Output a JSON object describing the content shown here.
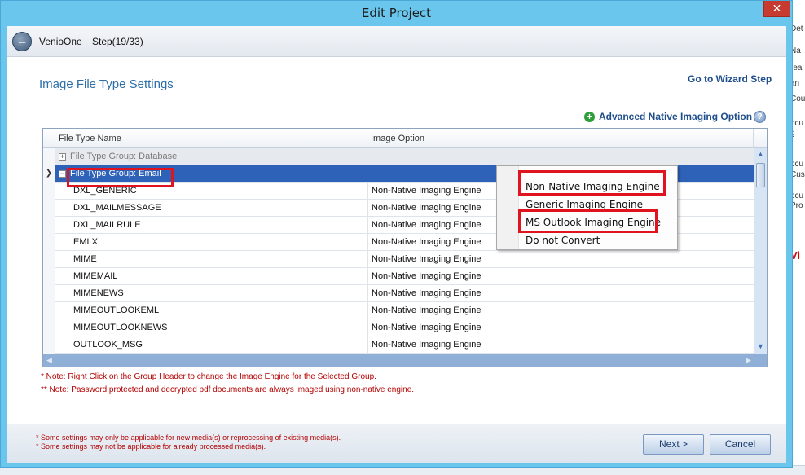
{
  "window": {
    "title": "Edit Project",
    "close_label": "✕"
  },
  "nav": {
    "app": "VenioOne",
    "step": "Step(19/33)"
  },
  "page": {
    "title": "Image File Type Settings",
    "wizard_link": "Go to Wizard Step",
    "advanced_option": "Advanced Native Imaging Option"
  },
  "grid": {
    "headers": [
      "File Type Name",
      "Image Option"
    ],
    "groups": [
      {
        "label": "File Type Group: Database",
        "expand_symbol": "+"
      },
      {
        "label": "File Type Group: Email",
        "expand_symbol": "−",
        "selected": true
      }
    ],
    "rows": [
      {
        "name": "DXL_GENERIC",
        "option": "Non-Native Imaging Engine"
      },
      {
        "name": "DXL_MAILMESSAGE",
        "option": "Non-Native Imaging Engine"
      },
      {
        "name": "DXL_MAILRULE",
        "option": "Non-Native Imaging Engine"
      },
      {
        "name": "EMLX",
        "option": "Non-Native Imaging Engine"
      },
      {
        "name": "MIME",
        "option": "Non-Native Imaging Engine"
      },
      {
        "name": "MIMEMAIL",
        "option": "Non-Native Imaging Engine"
      },
      {
        "name": "MIMENEWS",
        "option": "Non-Native Imaging Engine"
      },
      {
        "name": "MIMEOUTLOOKEML",
        "option": "Non-Native Imaging Engine"
      },
      {
        "name": "MIMEOUTLOOKNEWS",
        "option": "Non-Native Imaging Engine"
      },
      {
        "name": "OUTLOOK_MSG",
        "option": "Non-Native Imaging Engine"
      }
    ]
  },
  "context_menu": {
    "items": [
      "Non-Native Imaging Engine",
      "Generic Imaging Engine",
      "MS Outlook Imaging Engine",
      "Do not Convert"
    ]
  },
  "notes": {
    "note1": "* Note: Right Click on the Group Header to change the Image Engine for the Selected Group.",
    "note2": "** Note: Password protected and decrypted pdf documents are always imaged using non-native engine."
  },
  "footer": {
    "note1": "* Some settings may only be applicable for new media(s) or reprocessing of existing media(s).",
    "note2": "* Some settings may not be applicable for already processed media(s).",
    "next_label": "Next >",
    "cancel_label": "Cancel"
  },
  "background": {
    "fragments": [
      "Det",
      "Na",
      "rea",
      "an",
      "Cou",
      "ocu",
      "g",
      "ocu",
      "Cus",
      "ocu",
      "Pro",
      "Vi"
    ]
  },
  "colors": {
    "accent": "#2c6fa8",
    "selection": "#2e62b8",
    "highlight": "#e0141e",
    "note": "#b40000",
    "title_bar": "#6ac6ec"
  }
}
